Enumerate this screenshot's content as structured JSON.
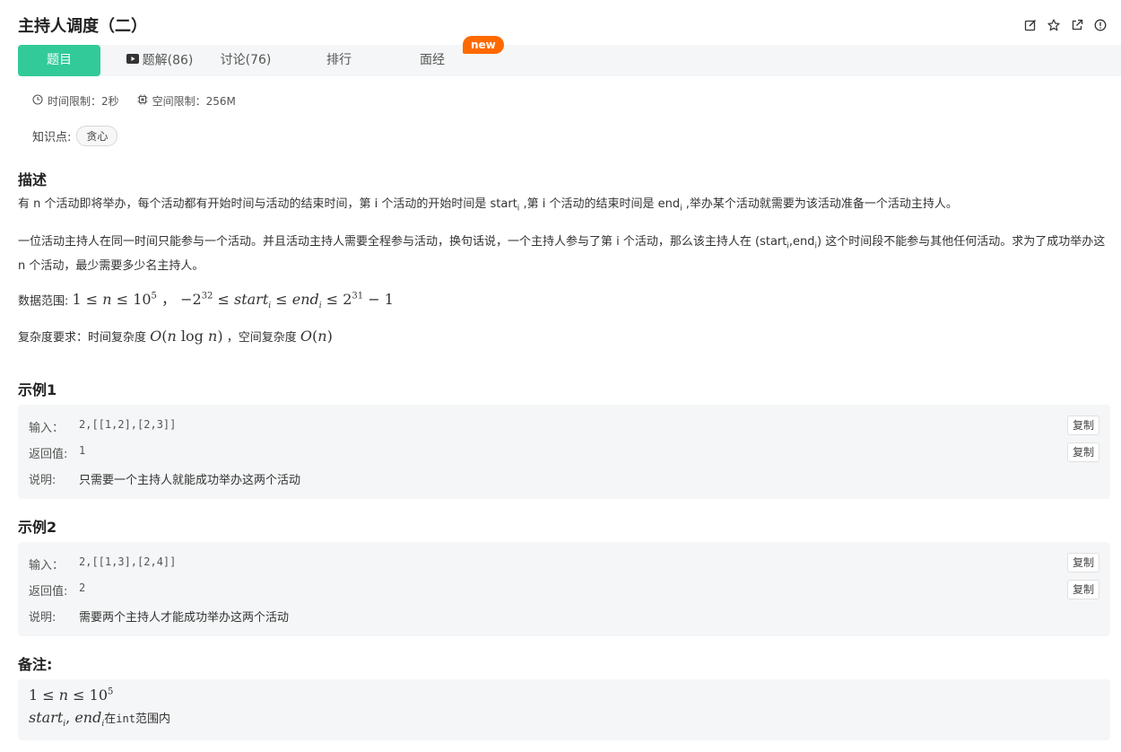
{
  "header": {
    "title": "主持人调度（二）",
    "icons": [
      "edit-icon",
      "star-icon",
      "external-link-icon",
      "info-icon"
    ]
  },
  "tabs": [
    {
      "label": "题目",
      "active": true
    },
    {
      "label": "题解(86)",
      "icon": "video-icon"
    },
    {
      "label": "讨论(76)"
    },
    {
      "label": "排行"
    },
    {
      "label": "面经",
      "badge": "new"
    }
  ],
  "meta": {
    "time_limit": "时间限制：2秒",
    "space_limit": "空间限制：256M"
  },
  "knowledge": {
    "label": "知识点:",
    "tag": "贪心"
  },
  "description": {
    "heading": "描述",
    "p1_a": "有 n 个活动即将举办，每个活动都有开始时间与活动的结束时间，第 i 个活动的开始时间是 start",
    "p1_sub1": "i",
    "p1_b": " ,第 i 个活动的结束时间是 end",
    "p1_sub2": "i",
    "p1_c": " ,举办某个活动就需要为该活动准备一个活动主持人。",
    "p2_a": "一位活动主持人在同一时间只能参与一个活动。并且活动主持人需要全程参与活动，换句话说，一个主持人参与了第 i 个活动，那么该主持人在 (start",
    "p2_sub1": "i",
    "p2_b": ",end",
    "p2_sub2": "i",
    "p2_c": ") 这个时间段不能参与其他任何活动。求为了成功举办这 n 个活动，最少需要多少名主持人。",
    "range_label": "数据范围:",
    "complexity_label": "复杂度要求：时间复杂度",
    "complexity_mid": "，空间复杂度"
  },
  "examples": [
    {
      "heading": "示例1",
      "input_label": "输入：",
      "input": "2,[[1,2],[2,3]]",
      "output_label": "返回值:",
      "output": "1",
      "explain_label": "说明:",
      "explain": "只需要一个主持人就能成功举办这两个活动",
      "copy": "复制"
    },
    {
      "heading": "示例2",
      "input_label": "输入：",
      "input": "2,[[1,3],[2,4]]",
      "output_label": "返回值:",
      "output": "2",
      "explain_label": "说明:",
      "explain": "需要两个主持人才能成功举办这两个活动",
      "copy": "复制"
    }
  ],
  "notes": {
    "heading": "备注:",
    "line2_code": "int",
    "line2_a": "在",
    "line2_b": "范围内"
  }
}
